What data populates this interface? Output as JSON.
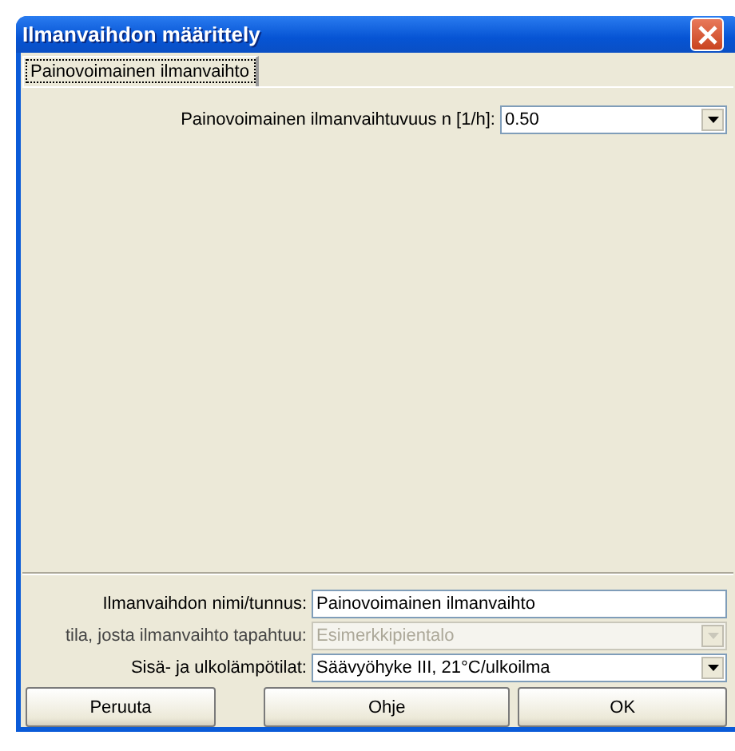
{
  "window": {
    "title": "Ilmanvaihdon määrittely"
  },
  "tabs": [
    {
      "label": "Painovoimainen ilmanvaihto",
      "selected": true
    }
  ],
  "tab_fields": [
    {
      "kind": "dropdown",
      "label": "Painovoimainen ilmanvaihtuvuus n [1/h]:",
      "value": "0.50",
      "disabled": false
    }
  ],
  "fields": [
    {
      "kind": "text",
      "label": "Ilmanvaihdon nimi/tunnus:",
      "value": "Painovoimainen ilmanvaihto",
      "disabled": false
    },
    {
      "kind": "dropdown",
      "label": "tila, josta ilmanvaihto tapahtuu:",
      "value": "Esimerkkipientalo",
      "disabled": true
    },
    {
      "kind": "dropdown",
      "label": "Sisä- ja ulkolämpötilat:",
      "value": "Säävyöhyke III, 21°C/ulkoilma",
      "disabled": false
    }
  ],
  "buttons": [
    "Peruuta",
    "Ohje",
    "OK"
  ]
}
